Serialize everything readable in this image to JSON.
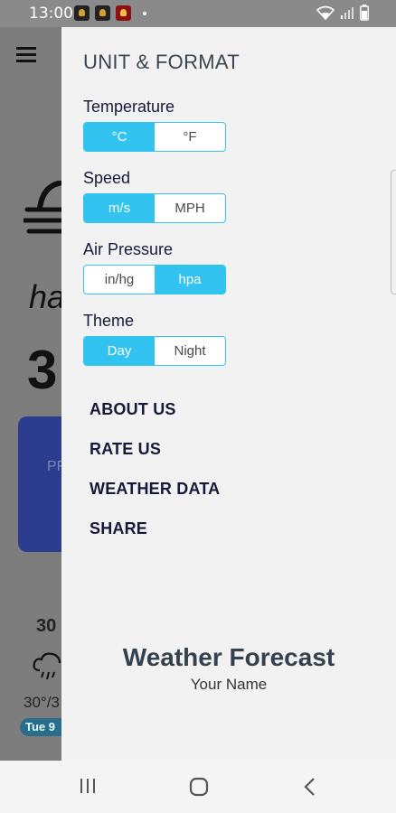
{
  "status_bar": {
    "time": "13:00",
    "notifications": [
      "app-notification-icon",
      "app-notification-icon",
      "app-notification-icon"
    ],
    "icons": [
      "wifi-icon",
      "signal-icon",
      "battery-icon"
    ]
  },
  "background": {
    "condition_partial": "ha",
    "temp_partial": "3",
    "card_partial": "PF",
    "day_temp_partial": "30",
    "range_partial": "30°/3",
    "date_partial": "Tue 9"
  },
  "drawer": {
    "title": "UNIT & FORMAT",
    "settings": [
      {
        "label": "Temperature",
        "options": [
          "°C",
          "°F"
        ],
        "selected": 0
      },
      {
        "label": "Speed",
        "options": [
          "m/s",
          "MPH"
        ],
        "selected": 0
      },
      {
        "label": "Air Pressure",
        "options": [
          "in/hg",
          "hpa"
        ],
        "selected": 1
      },
      {
        "label": "Theme",
        "options": [
          "Day",
          "Night"
        ],
        "selected": 0
      }
    ],
    "menu": [
      "ABOUT US",
      "RATE US",
      "WEATHER DATA",
      "SHARE"
    ],
    "brand_title": "Weather Forecast",
    "brand_subtitle": "Your Name"
  },
  "colors": {
    "accent": "#33c3f0",
    "drawer_bg": "#f2f2f2",
    "text_dark": "#161a3a"
  }
}
